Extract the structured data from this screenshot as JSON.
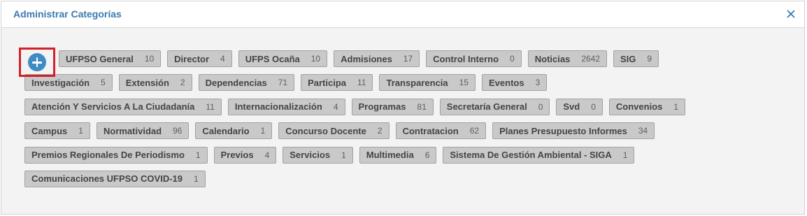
{
  "dialog": {
    "title": "Administrar Categorías",
    "close_icon": "close-icon"
  },
  "add_icon": "plus-circle-icon",
  "colors": {
    "title": "#3b7ab0",
    "chip_bg": "#c9c9c9",
    "add_button": "#3f8cc4",
    "highlight_border": "#d3212a"
  },
  "categories": [
    {
      "label": "UFPSO General",
      "count": "10"
    },
    {
      "label": "Director",
      "count": "4"
    },
    {
      "label": "UFPS Ocaña",
      "count": "10"
    },
    {
      "label": "Admisiones",
      "count": "17"
    },
    {
      "label": "Control Interno",
      "count": "0"
    },
    {
      "label": "Noticias",
      "count": "2642"
    },
    {
      "label": "SIG",
      "count": "9"
    },
    {
      "label": "Investigación",
      "count": "5"
    },
    {
      "label": "Extensión",
      "count": "2"
    },
    {
      "label": "Dependencias",
      "count": "71"
    },
    {
      "label": "Participa",
      "count": "11"
    },
    {
      "label": "Transparencia",
      "count": "15"
    },
    {
      "label": "Eventos",
      "count": "3"
    },
    {
      "label": "Atención Y Servicios A La Ciudadanía",
      "count": "11"
    },
    {
      "label": "Internacionalización",
      "count": "4"
    },
    {
      "label": "Programas",
      "count": "81"
    },
    {
      "label": "Secretaría General",
      "count": "0"
    },
    {
      "label": "Svd",
      "count": "0"
    },
    {
      "label": "Convenios",
      "count": "1"
    },
    {
      "label": "Campus",
      "count": "1"
    },
    {
      "label": "Normatividad",
      "count": "96"
    },
    {
      "label": "Calendario",
      "count": "1"
    },
    {
      "label": "Concurso Docente",
      "count": "2"
    },
    {
      "label": "Contratacion",
      "count": "62"
    },
    {
      "label": "Planes Presupuesto Informes",
      "count": "34"
    },
    {
      "label": "Premios Regionales De Periodismo",
      "count": "1"
    },
    {
      "label": "Previos",
      "count": "4"
    },
    {
      "label": "Servicios",
      "count": "1"
    },
    {
      "label": "Multimedia",
      "count": "6"
    },
    {
      "label": "Sistema De Gestión Ambiental - SIGA",
      "count": "1"
    },
    {
      "label": "Comunicaciones UFPSO COVID-19",
      "count": "1"
    }
  ]
}
